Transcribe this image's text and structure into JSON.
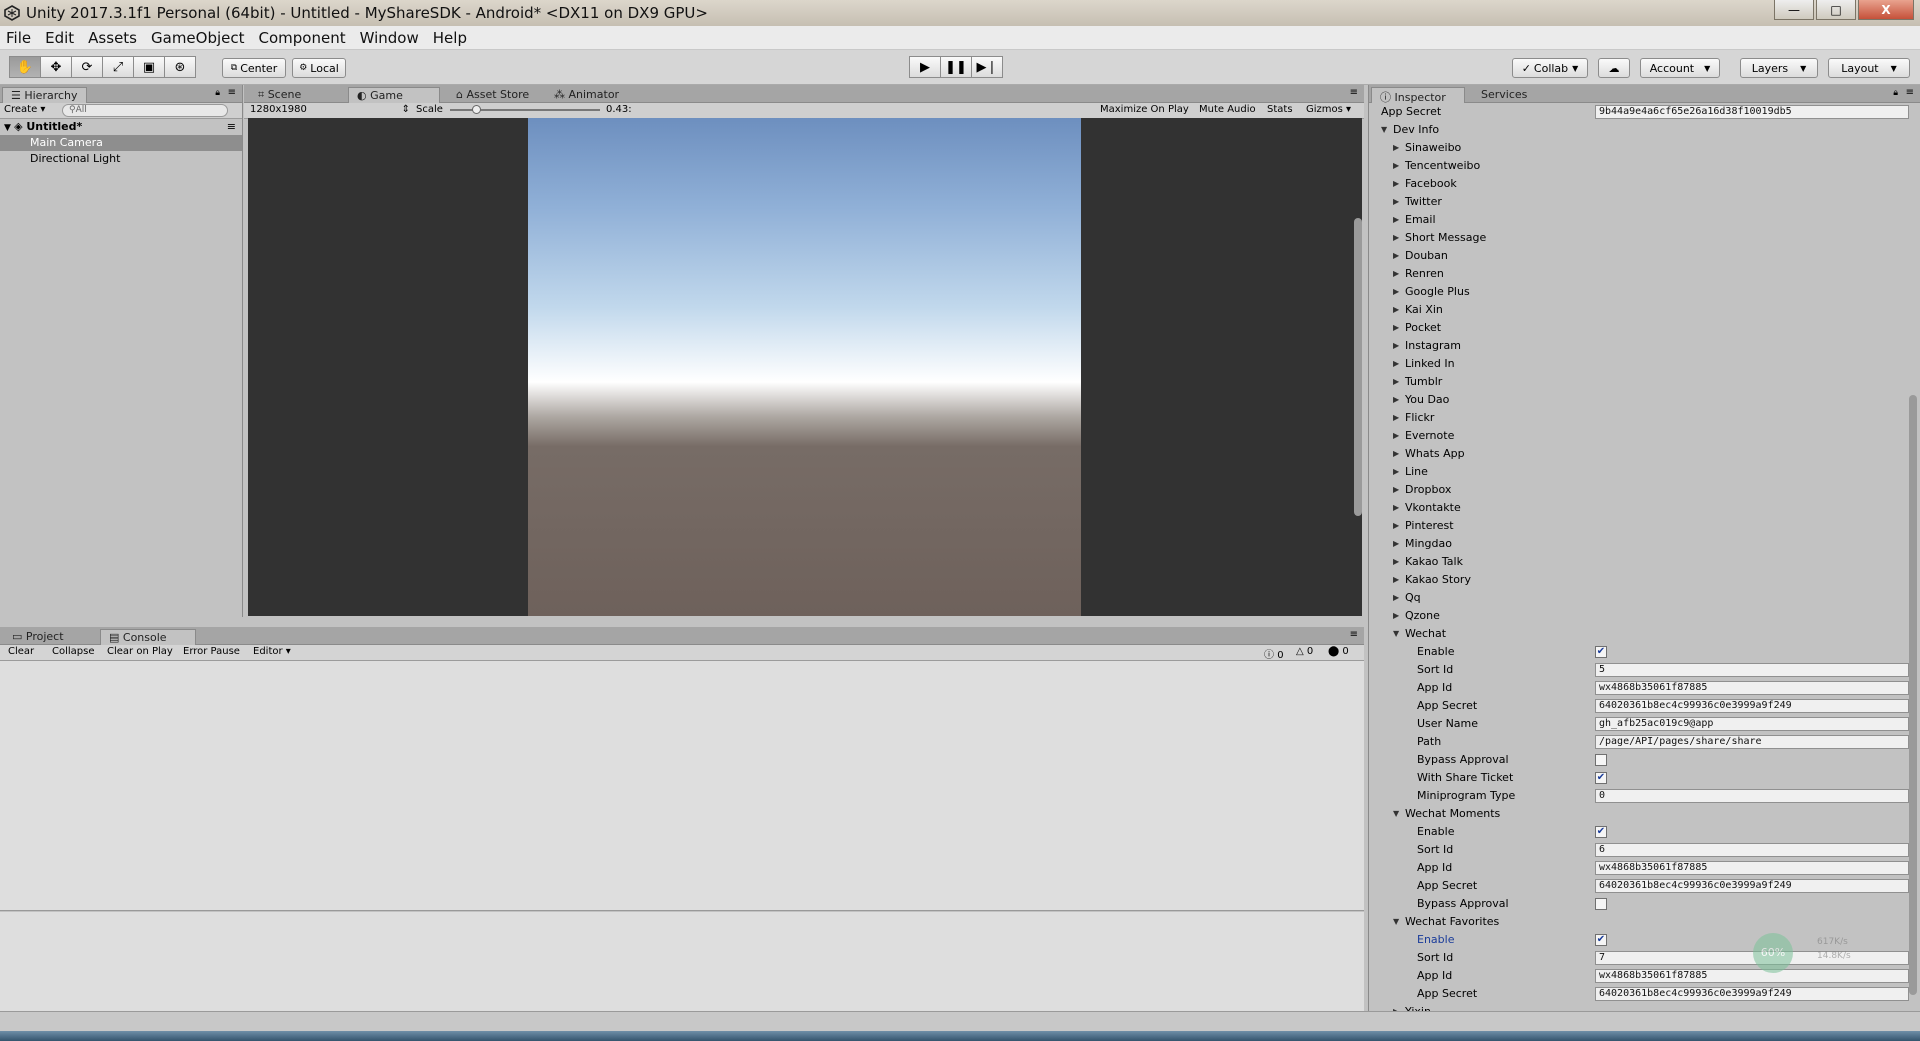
{
  "window": {
    "title": "Unity 2017.3.1f1 Personal (64bit) - Untitled - MyShareSDK - Android* <DX11 on DX9 GPU>",
    "minimize": "—",
    "maximize": "□",
    "close": "X"
  },
  "menu": [
    "File",
    "Edit",
    "Assets",
    "GameObject",
    "Component",
    "Window",
    "Help"
  ],
  "toolbar": {
    "center": "Center",
    "local": "Local",
    "collab": "Collab",
    "account": "Account",
    "layers": "Layers",
    "layout": "Layout"
  },
  "hierarchy": {
    "tab": "Hierarchy",
    "create": "Create",
    "search_placeholder": "All",
    "scene": "Untitled*",
    "items": [
      "Main Camera",
      "Directional Light"
    ],
    "selected": "Main Camera"
  },
  "scene_tabs": [
    "Scene",
    "Game",
    "Asset Store",
    "Animator"
  ],
  "game": {
    "resolution": "1280x1980",
    "scale_label": "Scale",
    "scale_value": "0.43:",
    "options": [
      "Maximize On Play",
      "Mute Audio",
      "Stats",
      "Gizmos"
    ]
  },
  "console": {
    "tabs": [
      "Project",
      "Console"
    ],
    "buttons": [
      "Clear",
      "Collapse",
      "Clear on Play",
      "Error Pause",
      "Editor"
    ],
    "counts": [
      "0",
      "0",
      "0"
    ]
  },
  "inspector": {
    "tabs": [
      "Inspector",
      "Services"
    ],
    "top_label": "App Secret",
    "top_value": "9b44a9e4a6cf65e26a16d38f10019db5",
    "dev_info": "Dev Info",
    "platforms": [
      "Sinaweibo",
      "Tencentweibo",
      "Facebook",
      "Twitter",
      "Email",
      "Short Message",
      "Douban",
      "Renren",
      "Google Plus",
      "Kai Xin",
      "Pocket",
      "Instagram",
      "Linked In",
      "Tumblr",
      "You Dao",
      "Flickr",
      "Evernote",
      "Whats App",
      "Line",
      "Dropbox",
      "Vkontakte",
      "Pinterest",
      "Mingdao",
      "Kakao Talk",
      "Kakao Story",
      "Qq",
      "Qzone"
    ],
    "wechat": {
      "label": "Wechat",
      "fields": [
        {
          "label": "Enable",
          "type": "check",
          "value": "✔"
        },
        {
          "label": "Sort Id",
          "type": "text",
          "value": "5"
        },
        {
          "label": "App Id",
          "type": "text",
          "value": "wx4868b35061f87885"
        },
        {
          "label": "App Secret",
          "type": "text",
          "value": "64020361b8ec4c99936c0e3999a9f249"
        },
        {
          "label": "User Name",
          "type": "text",
          "value": "gh_afb25ac019c9@app"
        },
        {
          "label": "Path",
          "type": "text",
          "value": "/page/API/pages/share/share"
        },
        {
          "label": "Bypass Approval",
          "type": "check",
          "value": ""
        },
        {
          "label": "With Share Ticket",
          "type": "check",
          "value": "✔"
        },
        {
          "label": "Miniprogram Type",
          "type": "text",
          "value": "0"
        }
      ]
    },
    "moments": {
      "label": "Wechat Moments",
      "fields": [
        {
          "label": "Enable",
          "type": "check",
          "value": "✔"
        },
        {
          "label": "Sort Id",
          "type": "text",
          "value": "6"
        },
        {
          "label": "App Id",
          "type": "text",
          "value": "wx4868b35061f87885"
        },
        {
          "label": "App Secret",
          "type": "text",
          "value": "64020361b8ec4c99936c0e3999a9f249"
        },
        {
          "label": "Bypass Approval",
          "type": "check",
          "value": ""
        }
      ]
    },
    "favorites": {
      "label": "Wechat Favorites",
      "fields": [
        {
          "label": "Enable",
          "type": "check",
          "value": "✔"
        },
        {
          "label": "Sort Id",
          "type": "text",
          "value": "7"
        },
        {
          "label": "App Id",
          "type": "text",
          "value": "wx4868b35061f87885"
        },
        {
          "label": "App Secret",
          "type": "text",
          "value": "64020361b8ec4c99936c0e3999a9f249"
        }
      ]
    },
    "last": "Yixin",
    "overlay": {
      "percent": "60%",
      "up": "617K/s",
      "down": "14.8K/s"
    }
  },
  "colors": {
    "selected_row": "#8e8e8e",
    "highlight_label": "#1a3c9a"
  }
}
